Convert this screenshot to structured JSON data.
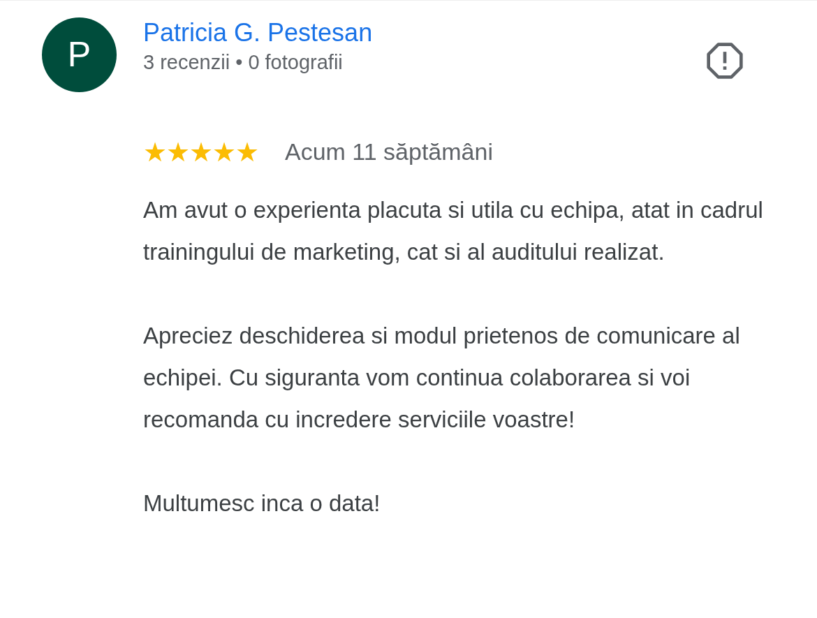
{
  "reviewer": {
    "initial": "P",
    "name": "Patricia G. Pestesan",
    "meta": "3 recenzii • 0 fotografii"
  },
  "review": {
    "stars": 5,
    "time": "Acum 11 săptămâni",
    "paragraphs": [
      "Am avut o experienta placuta si utila cu echipa, atat in cadrul trainingului de marketing, cat si al auditului realizat.",
      "Apreciez deschiderea si modul prietenos de comunicare al echipei. Cu siguranta vom continua colaborarea si voi recomanda cu incredere serviciile voastre!",
      "Multumesc inca o data!"
    ]
  }
}
